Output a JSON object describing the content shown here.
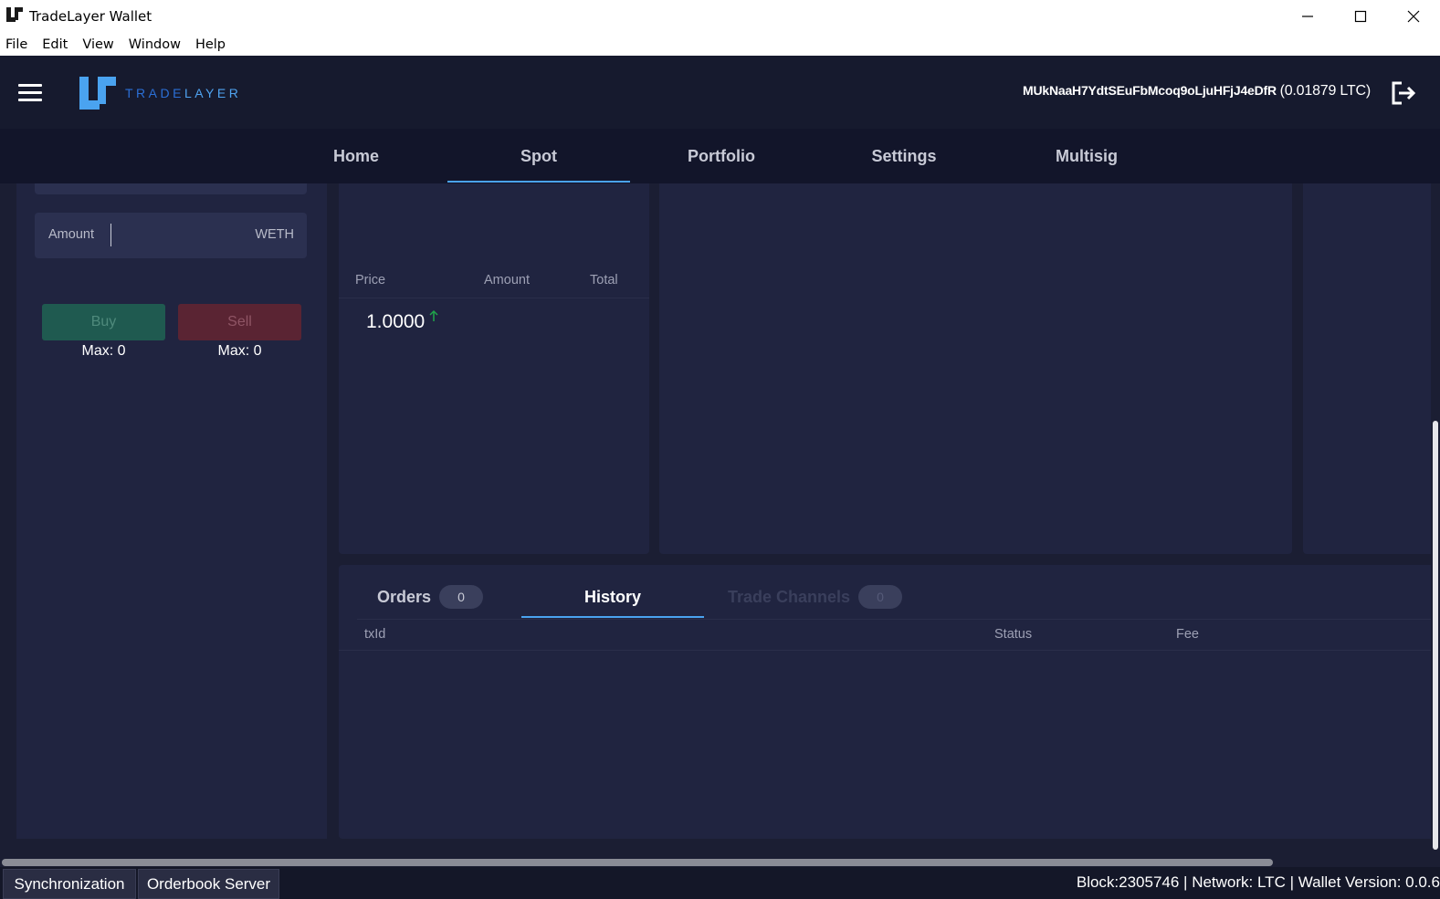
{
  "window": {
    "title": "TradeLayer Wallet"
  },
  "menu": {
    "items": [
      "File",
      "Edit",
      "View",
      "Window",
      "Help"
    ]
  },
  "header": {
    "logo_text_part1": "TRADE",
    "logo_text_part2": "LAYER",
    "wallet_address": "MUkNaaH7YdtSEuFbMcoq9oLjuHFjJ4eDfR",
    "wallet_balance": "(0.01879 LTC)"
  },
  "nav": {
    "tabs": [
      {
        "label": "Home"
      },
      {
        "label": "Spot"
      },
      {
        "label": "Portfolio"
      },
      {
        "label": "Settings"
      },
      {
        "label": "Multisig"
      }
    ],
    "active": "Spot"
  },
  "trade_form": {
    "amount_label": "Amount",
    "amount_value": "",
    "amount_unit": "WETH",
    "buy_label": "Buy",
    "sell_label": "Sell",
    "buy_max": "Max: 0",
    "sell_max": "Max: 0"
  },
  "orderbook": {
    "columns": [
      "Price",
      "Amount",
      "Total"
    ],
    "last_price": "1.0000",
    "trend_color": "#1fa64a"
  },
  "bottom_tabs": {
    "orders_label": "Orders",
    "orders_count": "0",
    "history_label": "History",
    "channels_label": "Trade Channels",
    "channels_count": "0",
    "active": "History",
    "columns": [
      "txId",
      "Status",
      "Fee"
    ]
  },
  "statusbar": {
    "sync_label": "Synchronization",
    "orderbook_label": "Orderbook Server",
    "status_text": "Block:2305746 | Network: LTC | Wallet Version: 0.0.6"
  },
  "colors": {
    "accent": "#4aa3f0",
    "background": "#1b1e33",
    "panel": "#202440",
    "buy": "#1f5a50",
    "sell": "#5a2433"
  }
}
